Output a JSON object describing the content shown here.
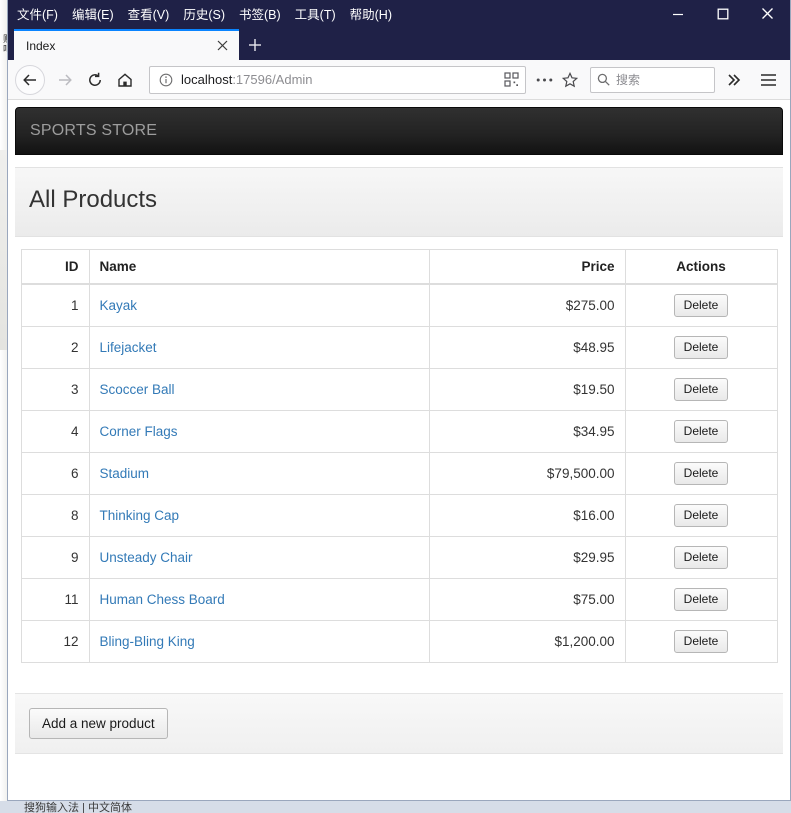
{
  "browser": {
    "menu_items": [
      {
        "label": "文件(F)",
        "accel": "F"
      },
      {
        "label": "编辑(E)",
        "accel": "E"
      },
      {
        "label": "查看(V)",
        "accel": "V"
      },
      {
        "label": "历史(S)",
        "accel": "S"
      },
      {
        "label": "书签(B)",
        "accel": "B"
      },
      {
        "label": "工具(T)",
        "accel": "T"
      },
      {
        "label": "帮助(H)",
        "accel": "H"
      }
    ],
    "window_controls": {
      "minimize": "minimize-icon",
      "maximize": "maximize-icon",
      "close": "close-icon"
    },
    "tab": {
      "title": "Index",
      "close_label": "×",
      "new_tab_label": "+"
    },
    "toolbar": {
      "back_icon": "back-arrow-icon",
      "forward_icon": "forward-arrow-icon",
      "reload_icon": "reload-icon",
      "home_icon": "home-icon",
      "info_icon": "info-circle-icon",
      "reader_icon": "qr-reader-icon",
      "dots_icon": "page-actions-ellipsis-icon",
      "star_icon": "bookmark-star-icon",
      "overflow_icon": "chevron-double-right-icon",
      "hamburger_icon": "hamburger-menu-icon"
    },
    "url": {
      "host": "localhost",
      "rest": ":17596/Admin",
      "full": "localhost:17596/Admin"
    },
    "search": {
      "placeholder": "搜索",
      "icon": "search-icon",
      "value": ""
    }
  },
  "site": {
    "brand": "SPORTS STORE",
    "page_title": "All Products",
    "table": {
      "headers": {
        "id": "ID",
        "name": "Name",
        "price": "Price",
        "actions": "Actions"
      },
      "rows": [
        {
          "id": "1",
          "name": "Kayak",
          "price": "$275.00"
        },
        {
          "id": "2",
          "name": "Lifejacket",
          "price": "$48.95"
        },
        {
          "id": "3",
          "name": "Scoccer Ball",
          "price": "$19.50"
        },
        {
          "id": "4",
          "name": "Corner Flags",
          "price": "$34.95"
        },
        {
          "id": "6",
          "name": "Stadium",
          "price": "$79,500.00"
        },
        {
          "id": "8",
          "name": "Thinking Cap",
          "price": "$16.00"
        },
        {
          "id": "9",
          "name": "Unsteady Chair",
          "price": "$29.95"
        },
        {
          "id": "11",
          "name": "Human Chess Board",
          "price": "$75.00"
        },
        {
          "id": "12",
          "name": "Bling-Bling King",
          "price": "$1,200.00"
        }
      ],
      "delete_label": "Delete"
    },
    "add_product_label": "Add a new product"
  },
  "background_windows": {
    "left_vertical_text": "贴吧",
    "bottom_text": "搜狗输入法 | 中文简体"
  },
  "colors": {
    "titlebar": "#1f2147",
    "tab_accent": "#0a84ff",
    "site_navbar_dark": "#222222",
    "brand_text": "#9d9d9d",
    "link": "#337ab7",
    "table_border": "#dddddd",
    "panel_heading": "#f0f0f0"
  }
}
